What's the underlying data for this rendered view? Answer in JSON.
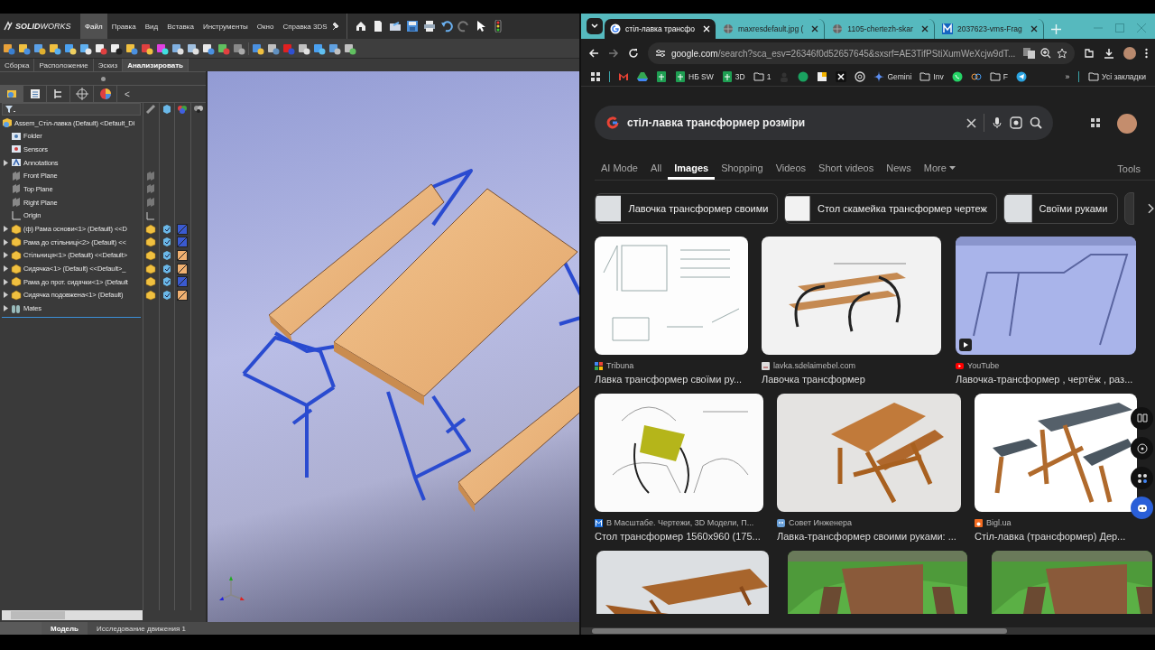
{
  "solidworks": {
    "logo": "**SOLID**WORKS",
    "menu": [
      {
        "label": "Файл",
        "selected": true
      },
      {
        "label": "Правка",
        "selected": false
      },
      {
        "label": "Вид",
        "selected": false
      },
      {
        "label": "Вставка",
        "selected": false
      },
      {
        "label": "Инструменты",
        "selected": false
      },
      {
        "label": "Окно",
        "selected": false
      },
      {
        "label": "Справка 3DS",
        "selected": false
      }
    ],
    "ribbon_tabs": [
      {
        "label": "Сборка",
        "selected": false
      },
      {
        "label": "Расположение",
        "selected": false
      },
      {
        "label": "Эскиз",
        "selected": false
      },
      {
        "label": "Анализировать",
        "selected": true
      }
    ],
    "panel_tabs": [
      {
        "selected": true
      },
      {
        "selected": false
      },
      {
        "selected": false
      },
      {
        "selected": false
      },
      {
        "selected": false
      }
    ],
    "panel_collapse": "<",
    "tree": [
      {
        "kind": "assembly",
        "label": "Assem_Стіл-лавка (Default) <Default_Di",
        "expandable": false
      },
      {
        "kind": "folder",
        "label": "Folder",
        "expandable": false
      },
      {
        "kind": "sensors",
        "label": "Sensors",
        "expandable": false
      },
      {
        "kind": "annotations",
        "label": "Annotations",
        "expandable": true
      },
      {
        "kind": "plane",
        "label": "Front Plane",
        "expandable": false
      },
      {
        "kind": "plane",
        "label": "Top Plane",
        "expandable": false
      },
      {
        "kind": "plane",
        "label": "Right Plane",
        "expandable": false
      },
      {
        "kind": "origin",
        "label": "Origin",
        "expandable": false
      },
      {
        "kind": "part",
        "label": "(ф) Рама основи<1> (Default) <<D",
        "expandable": true,
        "color": "#3a5ad0"
      },
      {
        "kind": "part",
        "label": "Рама до стільниці<2> (Default) <<",
        "expandable": true,
        "color": "#3a5ad0"
      },
      {
        "kind": "part",
        "label": "Стільниця<1> (Default) <<Default>",
        "expandable": true,
        "color": "#f0b070"
      },
      {
        "kind": "part",
        "label": "Сидячка<1> (Default) <<Default>_",
        "expandable": true,
        "color": "#f0b070"
      },
      {
        "kind": "part",
        "label": "Рама до прот. сидячки<1> (Default",
        "expandable": true,
        "color": "#3a5ad0"
      },
      {
        "kind": "part",
        "label": "Сидячка  подовжена<1> (Default)",
        "expandable": true,
        "color": "#f0b070"
      },
      {
        "kind": "mates",
        "label": "Mates",
        "expandable": true
      }
    ],
    "bottom_tabs": [
      {
        "label": "Модель",
        "selected": true
      },
      {
        "label": "Исследование движения 1",
        "selected": false
      }
    ]
  },
  "browser": {
    "tabs": [
      {
        "title": "стіл-лавка трансфо",
        "selected": true
      },
      {
        "title": "maxresdefault.jpg (",
        "selected": false
      },
      {
        "title": "1105-chertezh-skar",
        "selected": false
      },
      {
        "title": "2037623-vms-Frag",
        "selected": false
      }
    ],
    "address": {
      "host": "google.com",
      "path": "/search?sca_esv=26346f0d52657645&sxsrf=AE3TifPStiXumWeXcjw9dT..."
    },
    "bookmarks": [
      {
        "kind": "apps"
      },
      {
        "kind": "mail"
      },
      {
        "kind": "drive"
      },
      {
        "kind": "sheet"
      },
      {
        "kind": "sheet",
        "label": "НБ SW"
      },
      {
        "kind": "sheet",
        "label": "3D"
      },
      {
        "kind": "folder",
        "label": "1"
      },
      {
        "kind": "dim"
      },
      {
        "kind": "round"
      },
      {
        "kind": "square"
      },
      {
        "kind": "scissors"
      },
      {
        "kind": "knot"
      },
      {
        "kind": "spark",
        "label": "Gemini"
      },
      {
        "kind": "folder",
        "label": "Inv"
      },
      {
        "kind": "chat"
      },
      {
        "kind": "rings"
      },
      {
        "kind": "folder",
        "label": "F"
      },
      {
        "kind": "plane"
      }
    ],
    "bookmarks_more": "»",
    "all_bookmarks": "Усі закладки",
    "search": {
      "value": "стіл-лавка трансформер розміри"
    },
    "nav": [
      {
        "label": "AI Mode",
        "selected": false
      },
      {
        "label": "All",
        "selected": false
      },
      {
        "label": "Images",
        "selected": true
      },
      {
        "label": "Shopping",
        "selected": false
      },
      {
        "label": "Videos",
        "selected": false
      },
      {
        "label": "Short videos",
        "selected": false
      },
      {
        "label": "News",
        "selected": false
      },
      {
        "label": "More",
        "selected": false
      }
    ],
    "tools": "Tools",
    "chips": [
      {
        "label": "Лавочка трансформер своими"
      },
      {
        "label": "Стол скамейка трансформер чертеж"
      },
      {
        "label": "Своїми руками"
      }
    ],
    "results": [
      [
        {
          "kind": "result",
          "source": "Tribuna",
          "title": "Лавка трансформер своїми ру...",
          "video": false
        },
        {
          "kind": "result",
          "source": "lavka.sdelaimebel.com",
          "title": "Лавочка трансформер",
          "video": false
        },
        {
          "kind": "result",
          "source": "YouTube",
          "title": "Лавочка-трансформер , чертёж , раз...",
          "video": true
        }
      ],
      [
        {
          "kind": "result",
          "source": "В Масштабе. Чертежи, 3D Модели, П...",
          "title": "Стол трансформер 1560x960 (175...",
          "video": false
        },
        {
          "kind": "result",
          "source": "Совет Инженера",
          "title": "Лавка-трансформер своими руками: ...",
          "video": false
        },
        {
          "kind": "result",
          "source": "Bigl.ua",
          "title": "Стіл-лавка (трансформер) Дер...",
          "video": false
        }
      ],
      [
        {
          "kind": "picture"
        },
        {
          "kind": "picture"
        },
        {
          "kind": "picture"
        }
      ]
    ]
  }
}
